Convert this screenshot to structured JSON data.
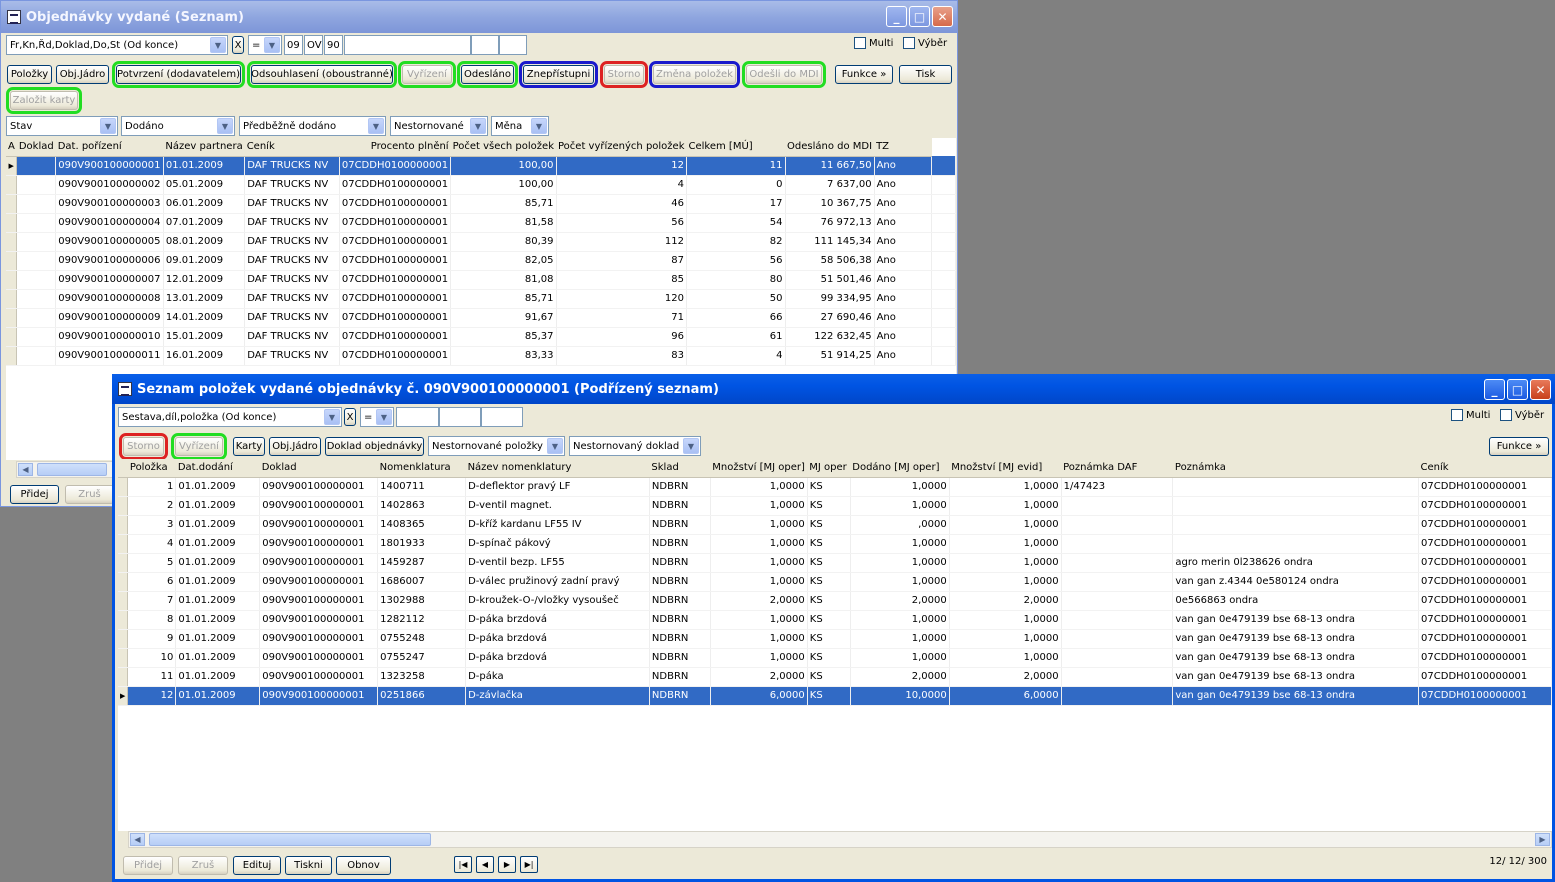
{
  "win1": {
    "title": "Objednávky vydané (Seznam)",
    "sort_combo": "Fr,Kn,Řd,Doklad,Do,St (Od konce)",
    "clear_x": "X",
    "operator": "=",
    "filter_parts": [
      "09",
      "OV",
      "90"
    ],
    "multi_label": "Multi",
    "vyber_label": "Výběr",
    "buttons": {
      "polozky": "Položky",
      "objjadro": "Obj.Jádro",
      "potvrzeni": "Potvrzení (dodavatelem)",
      "odsouhlaseni": "Odsouhlasení (oboustranné)",
      "vyrizeni": "Vyřízení",
      "odeslano": "Odesláno",
      "znepristupni": "Znepřístupni",
      "storno": "Storno",
      "zmena": "Změna položek",
      "odesli_mdi": "Odešli do MDI",
      "funkce": "Funkce »",
      "tisk": "Tisk",
      "zalozit": "Založit karty"
    },
    "filters": [
      "Stav",
      "Dodáno",
      "Předběžně dodáno",
      "Nestornované",
      "Měna"
    ],
    "columns": [
      "A",
      "Doklad",
      "Dat. pořízení",
      "Název partnera",
      "Ceník",
      "Procento plnění",
      "Počet všech položek",
      "Počet vyřízených položek",
      "Celkem [MÚ]",
      "Odesláno do MDI",
      "TZ"
    ],
    "rows": [
      [
        "090V900100000001",
        "01.01.2009",
        "DAF TRUCKS NV",
        "07CDDH0100000001",
        "100,00",
        "12",
        "11",
        "11 667,50",
        "Ano"
      ],
      [
        "090V900100000002",
        "05.01.2009",
        "DAF TRUCKS NV",
        "07CDDH0100000001",
        "100,00",
        "4",
        "0",
        "7 637,00",
        "Ano"
      ],
      [
        "090V900100000003",
        "06.01.2009",
        "DAF TRUCKS NV",
        "07CDDH0100000001",
        "85,71",
        "46",
        "17",
        "10 367,75",
        "Ano"
      ],
      [
        "090V900100000004",
        "07.01.2009",
        "DAF TRUCKS NV",
        "07CDDH0100000001",
        "81,58",
        "56",
        "54",
        "76 972,13",
        "Ano"
      ],
      [
        "090V900100000005",
        "08.01.2009",
        "DAF TRUCKS NV",
        "07CDDH0100000001",
        "80,39",
        "112",
        "82",
        "111 145,34",
        "Ano"
      ],
      [
        "090V900100000006",
        "09.01.2009",
        "DAF TRUCKS NV",
        "07CDDH0100000001",
        "82,05",
        "87",
        "56",
        "58 506,38",
        "Ano"
      ],
      [
        "090V900100000007",
        "12.01.2009",
        "DAF TRUCKS NV",
        "07CDDH0100000001",
        "81,08",
        "85",
        "80",
        "51 501,46",
        "Ano"
      ],
      [
        "090V900100000008",
        "13.01.2009",
        "DAF TRUCKS NV",
        "07CDDH0100000001",
        "85,71",
        "120",
        "50",
        "99 334,95",
        "Ano"
      ],
      [
        "090V900100000009",
        "14.01.2009",
        "DAF TRUCKS NV",
        "07CDDH0100000001",
        "91,67",
        "71",
        "66",
        "27 690,46",
        "Ano"
      ],
      [
        "090V900100000010",
        "15.01.2009",
        "DAF TRUCKS NV",
        "07CDDH0100000001",
        "85,37",
        "96",
        "61",
        "122 632,45",
        "Ano"
      ],
      [
        "090V900100000011",
        "16.01.2009",
        "DAF TRUCKS NV",
        "07CDDH0100000001",
        "83,33",
        "83",
        "4",
        "51 914,25",
        "Ano"
      ]
    ],
    "bottom": {
      "pridej": "Přidej",
      "zrus": "Zruš"
    }
  },
  "win2": {
    "title": "Seznam položek vydané objednávky č. 090V900100000001 (Podřízený seznam)",
    "sort_combo": "Sestava,díl,položka (Od konce)",
    "clear_x": "X",
    "operator": "=",
    "multi_label": "Multi",
    "vyber_label": "Výběr",
    "buttons": {
      "storno": "Storno",
      "vyrizeni": "Vyřízení",
      "karty": "Karty",
      "objjadro": "Obj.Jádro",
      "doklad": "Doklad objednávky",
      "funkce": "Funkce »"
    },
    "filters": [
      "Nestornované položky",
      "Nestornovaný doklad"
    ],
    "columns": [
      "Položka",
      "Dat.dodání",
      "Doklad",
      "Nomenklatura",
      "Název nomenklatury",
      "Sklad",
      "Množství [MJ oper]",
      "MJ oper",
      "Dodáno [MJ oper]",
      "Množství [MJ evid]",
      "Poznámka DAF",
      "Poznámka",
      "Ceník"
    ],
    "rows": [
      [
        "1",
        "01.01.2009",
        "090V900100000001",
        "1400711",
        "D-deflektor pravý LF",
        "NDBRN",
        "1,0000",
        "KS",
        "1,0000",
        "1,0000",
        "1/47423",
        "",
        "07CDDH0100000001"
      ],
      [
        "2",
        "01.01.2009",
        "090V900100000001",
        "1402863",
        "D-ventil magnet.",
        "NDBRN",
        "1,0000",
        "KS",
        "1,0000",
        "1,0000",
        "",
        "",
        "07CDDH0100000001"
      ],
      [
        "3",
        "01.01.2009",
        "090V900100000001",
        "1408365",
        "D-kříž kardanu LF55 IV",
        "NDBRN",
        "1,0000",
        "KS",
        ",0000",
        "1,0000",
        "",
        "",
        "07CDDH0100000001"
      ],
      [
        "4",
        "01.01.2009",
        "090V900100000001",
        "1801933",
        "D-spínač pákový",
        "NDBRN",
        "1,0000",
        "KS",
        "1,0000",
        "1,0000",
        "",
        "",
        "07CDDH0100000001"
      ],
      [
        "5",
        "01.01.2009",
        "090V900100000001",
        "1459287",
        "D-ventil bezp. LF55",
        "NDBRN",
        "1,0000",
        "KS",
        "1,0000",
        "1,0000",
        "",
        "agro merin 0l238626 ondra",
        "07CDDH0100000001"
      ],
      [
        "6",
        "01.01.2009",
        "090V900100000001",
        "1686007",
        "D-válec pružinový zadní pravý",
        "NDBRN",
        "1,0000",
        "KS",
        "1,0000",
        "1,0000",
        "",
        "van gan z.4344 0e580124 ondra",
        "07CDDH0100000001"
      ],
      [
        "7",
        "01.01.2009",
        "090V900100000001",
        "1302988",
        "D-kroužek-O-/vložky vysoušeč",
        "NDBRN",
        "2,0000",
        "KS",
        "2,0000",
        "2,0000",
        "",
        "0e566863 ondra",
        "07CDDH0100000001"
      ],
      [
        "8",
        "01.01.2009",
        "090V900100000001",
        "1282112",
        "D-páka brzdová",
        "NDBRN",
        "1,0000",
        "KS",
        "1,0000",
        "1,0000",
        "",
        "van gan 0e479139 bse 68-13 ondra",
        "07CDDH0100000001"
      ],
      [
        "9",
        "01.01.2009",
        "090V900100000001",
        "0755248",
        "D-páka brzdová",
        "NDBRN",
        "1,0000",
        "KS",
        "1,0000",
        "1,0000",
        "",
        "van gan 0e479139 bse 68-13 ondra",
        "07CDDH0100000001"
      ],
      [
        "10",
        "01.01.2009",
        "090V900100000001",
        "0755247",
        "D-páka brzdová",
        "NDBRN",
        "1,0000",
        "KS",
        "1,0000",
        "1,0000",
        "",
        "van gan 0e479139 bse 68-13 ondra",
        "07CDDH0100000001"
      ],
      [
        "11",
        "01.01.2009",
        "090V900100000001",
        "1323258",
        "D-páka",
        "NDBRN",
        "2,0000",
        "KS",
        "2,0000",
        "2,0000",
        "",
        "van gan 0e479139 bse 68-13 ondra",
        "07CDDH0100000001"
      ],
      [
        "12",
        "01.01.2009",
        "090V900100000001",
        "0251866",
        "D-závlačka",
        "NDBRN",
        "6,0000",
        "KS",
        "10,0000",
        "6,0000",
        "",
        "van gan 0e479139 bse 68-13 ondra",
        "07CDDH0100000001"
      ]
    ],
    "bottom": {
      "pridej": "Přidej",
      "zrus": "Zruš",
      "edituj": "Edituj",
      "tiskni": "Tiskni",
      "obnov": "Obnov",
      "record_counter": "12/ 12/ 300"
    }
  }
}
